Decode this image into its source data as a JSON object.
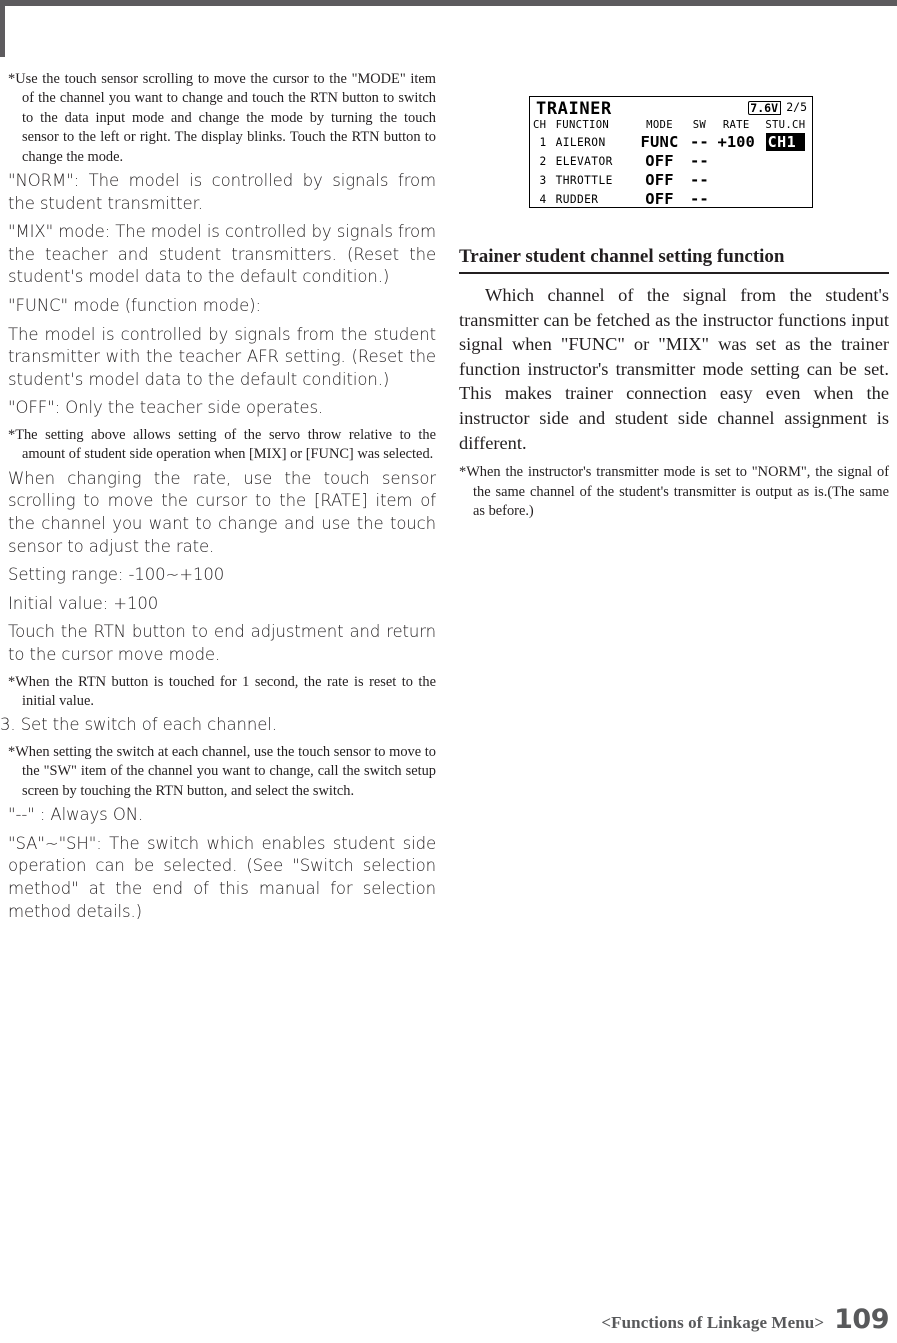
{
  "left_column": {
    "blocks": [
      {
        "style": "note",
        "text": "*Use the touch sensor scrolling to move the cursor to the \"MODE\" item of the channel you want to change and touch the RTN button to switch to the data input mode and change the mode by turning the touch sensor to the left or right. The display blinks. Touch the RTN button to change the mode."
      },
      {
        "style": "body",
        "text": "\"NORM\": The model is controlled by signals from the student transmitter."
      },
      {
        "style": "body",
        "text": "\"MIX\" mode: The model is controlled by signals from the teacher and student transmitters. (Reset the student's model data to the default condition.)"
      },
      {
        "style": "body-left",
        "text": "\"FUNC\" mode (function mode):"
      },
      {
        "style": "body",
        "text": "The model is controlled by signals from the student transmitter with the teacher AFR setting. (Reset the student's model data to the default condition.)"
      },
      {
        "style": "body-left",
        "text": "\"OFF\": Only the teacher side operates."
      },
      {
        "style": "note",
        "text": "*The setting above allows setting of the servo throw relative to the amount of student side operation when [MIX] or [FUNC] was selected."
      },
      {
        "style": "body",
        "text": "When changing the rate, use the touch sensor scrolling to move the cursor to the [RATE] item of the channel you want to change and use the touch sensor to adjust the rate."
      },
      {
        "style": "body-left",
        "text": "Setting range: -100~+100"
      },
      {
        "style": "body-left",
        "text": "Initial value: +100"
      },
      {
        "style": "body",
        "text": "Touch the RTN button to end adjustment and return to the cursor move mode."
      },
      {
        "style": "note",
        "text": "*When the RTN button is touched for 1 second, the rate is reset to the initial value."
      },
      {
        "style": "step",
        "text": "3. Set the switch of each channel."
      },
      {
        "style": "note",
        "text": "*When setting the switch at each channel, use the touch sensor to move to the \"SW\" item of the channel you want to change, call the switch setup screen by touching the RTN button, and select the switch."
      },
      {
        "style": "body-left",
        "text": "\"--\" : Always ON."
      },
      {
        "style": "body",
        "text": "\"SA\"~\"SH\": The switch which enables student side operation can be selected. (See \"Switch selection method\" at the end of this manual for selection method details.)"
      }
    ]
  },
  "lcd": {
    "title": "TRAINER",
    "battery": "7.6V",
    "page_indicator": "2/5",
    "headers": {
      "ch": "CH",
      "function": "FUNCTION",
      "mode": "MODE",
      "sw": "SW",
      "rate": "RATE",
      "stu_ch": "STU.CH"
    },
    "rows": [
      {
        "ch": "1",
        "function": "AILERON",
        "mode": "FUNC",
        "sw": "--",
        "rate": "+100",
        "stu_ch": "CH1",
        "stu_ch_highlighted": true
      },
      {
        "ch": "2",
        "function": "ELEVATOR",
        "mode": "OFF",
        "sw": "--",
        "rate": "",
        "stu_ch": "",
        "stu_ch_highlighted": false
      },
      {
        "ch": "3",
        "function": "THROTTLE",
        "mode": "OFF",
        "sw": "--",
        "rate": "",
        "stu_ch": "",
        "stu_ch_highlighted": false
      },
      {
        "ch": "4",
        "function": "RUDDER",
        "mode": "OFF",
        "sw": "--",
        "rate": "",
        "stu_ch": "",
        "stu_ch_highlighted": false
      }
    ]
  },
  "right_column": {
    "heading": "Trainer student channel setting function",
    "paragraph": "Which channel of the signal from the student's transmitter can be fetched as the instructor functions input signal when \"FUNC\" or \"MIX\" was set as the trainer function instructor's transmitter mode setting can be set. This makes trainer connection easy even when the instructor side and student side channel assignment is different.",
    "footnote": "*When the instructor's transmitter mode is set to \"NORM\", the signal of the same channel of the student's transmitter is output as is.(The same as before.)"
  },
  "footer": {
    "label": "<Functions of Linkage Menu>",
    "page_number": "109"
  }
}
